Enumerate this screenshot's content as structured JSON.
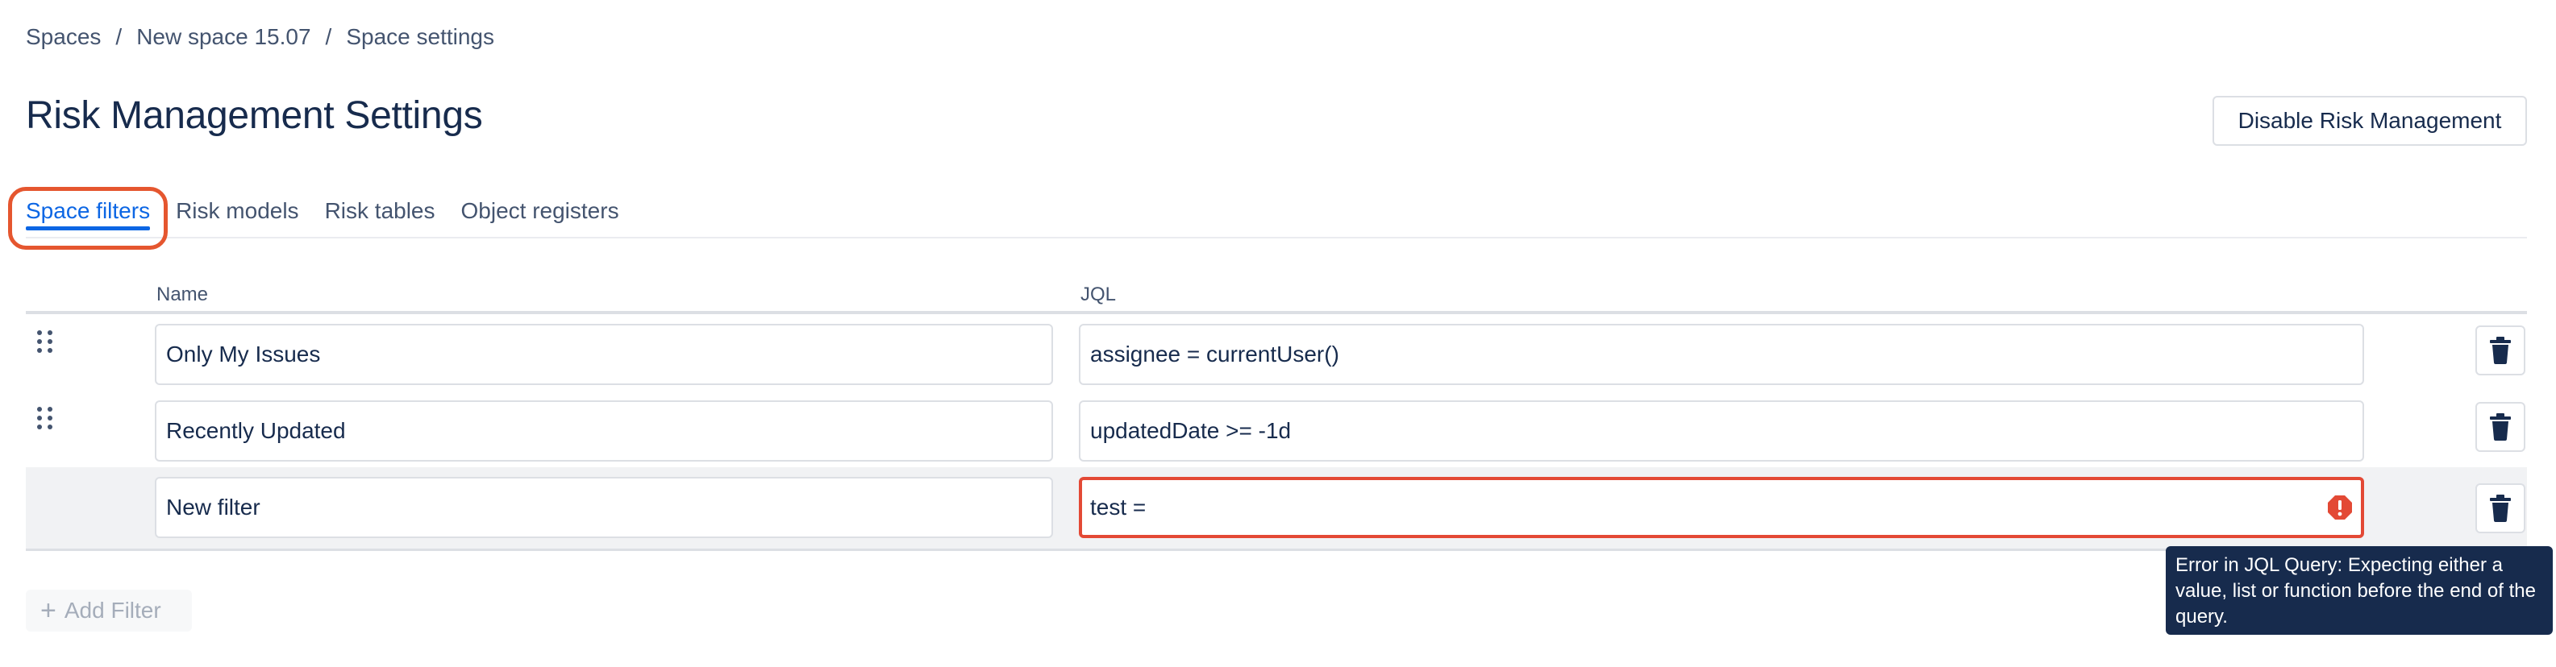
{
  "breadcrumb": {
    "items": [
      "Spaces",
      "New space 15.07",
      "Space settings"
    ],
    "separator": "/"
  },
  "page": {
    "title": "Risk Management Settings",
    "disable_button_label": "Disable Risk Management"
  },
  "tabs": [
    {
      "label": "Space filters",
      "active": true
    },
    {
      "label": "Risk models",
      "active": false
    },
    {
      "label": "Risk tables",
      "active": false
    },
    {
      "label": "Object registers",
      "active": false
    }
  ],
  "table": {
    "headers": {
      "name": "Name",
      "jql": "JQL"
    },
    "rows": [
      {
        "name": "Only My Issues",
        "jql": "assignee = currentUser()",
        "draggable": true,
        "error": false
      },
      {
        "name": "Recently Updated",
        "jql": "updatedDate >= -1d",
        "draggable": true,
        "error": false
      },
      {
        "name": "New filter",
        "jql": "test =",
        "draggable": false,
        "error": true
      }
    ]
  },
  "tooltip": {
    "text": "Error in JQL Query: Expecting either a value, list or function before the end of the query."
  },
  "add_filter": {
    "label": "Add Filter",
    "icon": "plus-icon"
  },
  "icons": {
    "drag": "drag-handle-icon",
    "delete": "trash-icon",
    "error": "error-icon"
  },
  "colors": {
    "accent": "#0c66e4",
    "error": "#e34935",
    "highlight": "#e5562f",
    "tooltip_bg": "#172b4d"
  }
}
